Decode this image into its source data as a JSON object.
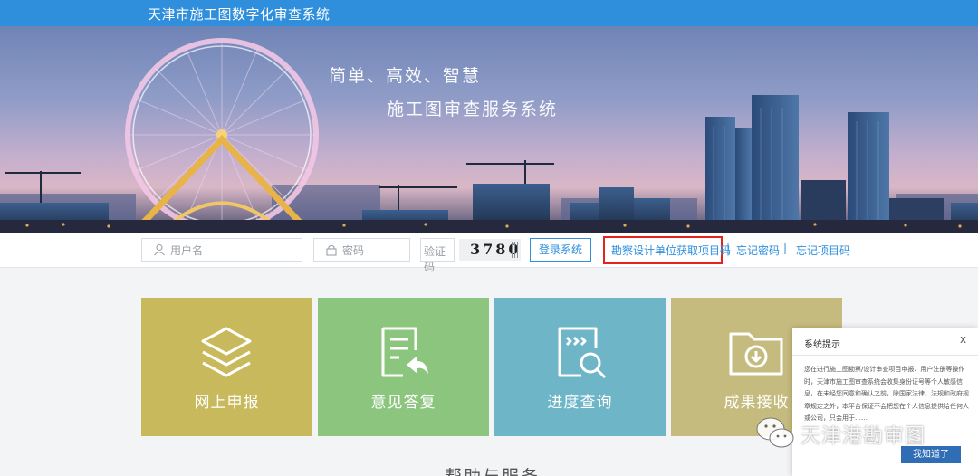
{
  "header": {
    "title": "天津市施工图数字化审查系统"
  },
  "banner": {
    "slogan_line1": "简单、高效、智慧",
    "slogan_line2": "施工图审查服务系统"
  },
  "login": {
    "username_placeholder": "用户名",
    "password_placeholder": "密码",
    "captcha_label": "验证码",
    "captcha_code": "3780",
    "login_button": "登录系统",
    "links": [
      "勘察设计单位获取项目码",
      "忘记密码",
      "忘记项目码"
    ],
    "separator": "|",
    "highlight_color": "#e5231b"
  },
  "tiles": [
    {
      "label": "网上申报",
      "icon": "layers-icon",
      "color": "#c8ba5c"
    },
    {
      "label": "意见答复",
      "icon": "document-reply-icon",
      "color": "#8cc57e"
    },
    {
      "label": "进度查询",
      "icon": "search-progress-icon",
      "color": "#6db5c7"
    },
    {
      "label": "成果接收",
      "icon": "folder-download-icon",
      "color": "#c6bb7e"
    }
  ],
  "help_section": {
    "title": "帮助与服务"
  },
  "popup": {
    "title": "系统提示",
    "close": "x",
    "body": "您在进行施工图勘察/设计审查项目申报、用户注册等操作时，天津市施工图审查系统会收集身份证号等个人敏感信息，在未经您同意和确认之前，除国家法律、法规和政府规章规定之外，本平台保证不会把您在个人信息提供给任何人或公司，只会用于……",
    "button": "我知道了"
  },
  "watermark": {
    "text": "天津港勘审图",
    "icon": "wechat-icon"
  },
  "colors": {
    "primary": "#2f8fdc",
    "topbar": "#2f8fdc",
    "popup_button": "#2f6db5"
  }
}
